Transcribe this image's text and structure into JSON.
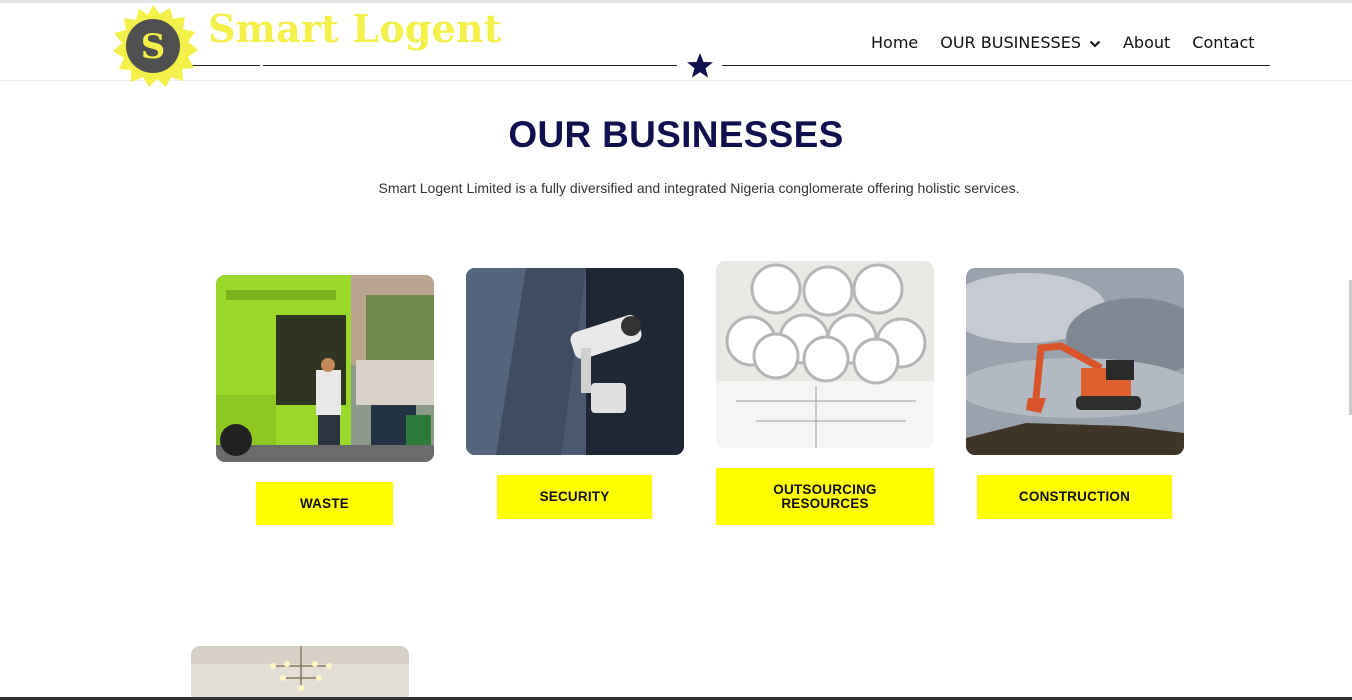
{
  "brand": {
    "name": "Smart Logent",
    "logo_letter": "S"
  },
  "nav": {
    "items": [
      {
        "label": "Home"
      },
      {
        "label": "OUR BUSINESSES",
        "has_dropdown": true
      },
      {
        "label": "About"
      },
      {
        "label": "Contact"
      }
    ]
  },
  "main": {
    "title": "OUR BUSINESSES",
    "subtitle": "Smart Logent Limited is a fully diversified and integrated Nigeria conglomerate offering holistic services.",
    "businesses": [
      {
        "label": "WASTE",
        "image": "garbage-truck-photo"
      },
      {
        "label": "SECURITY",
        "image": "cctv-camera-photo"
      },
      {
        "label_line1": "OUTSOURCING",
        "label_line2": "RESOURCES",
        "image": "blueprint-rolls-photo"
      },
      {
        "label": "CONSTRUCTION",
        "image": "excavator-photo"
      }
    ]
  },
  "colors": {
    "accent_yellow": "#ffff00",
    "title_navy": "#11104f",
    "logo_yellow": "#f3f04a",
    "logo_dark": "#505050"
  }
}
